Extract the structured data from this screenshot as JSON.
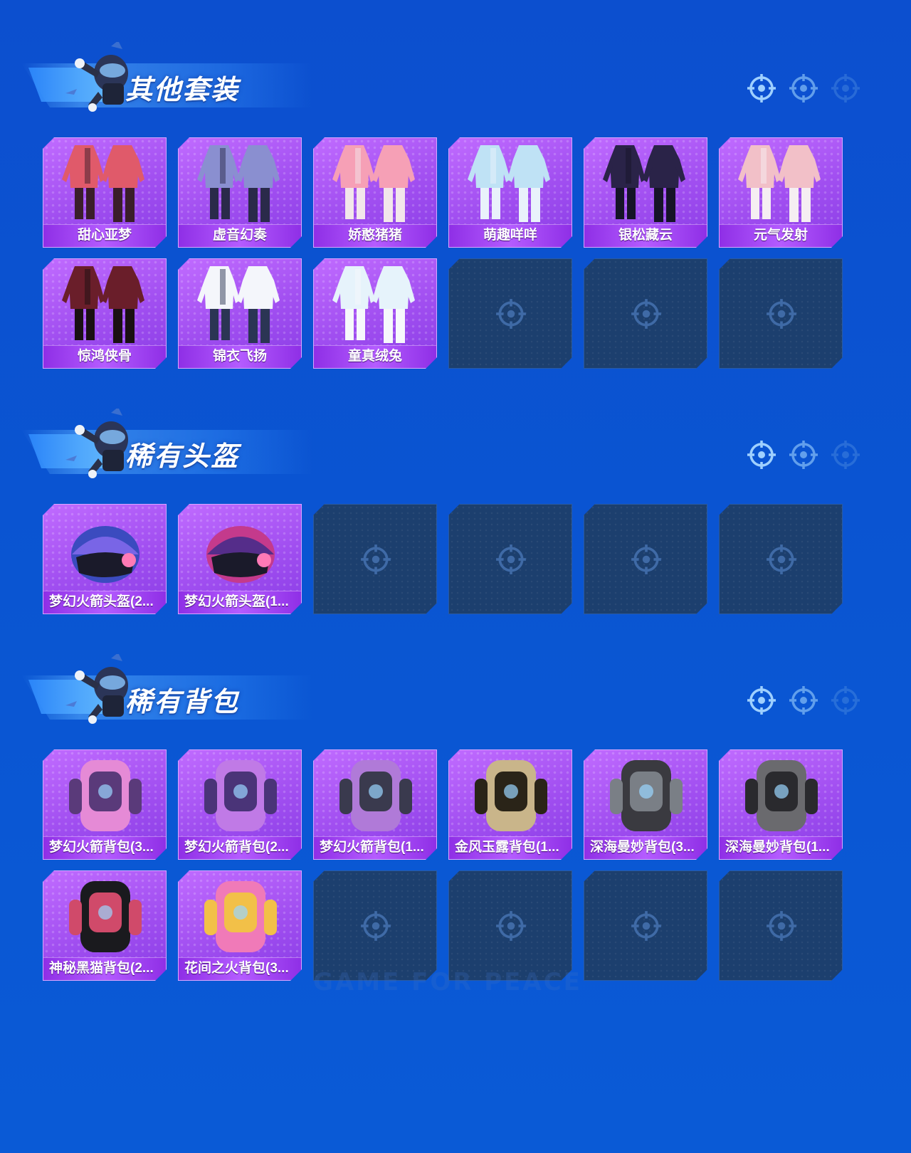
{
  "sections": [
    {
      "title": "其他套装",
      "rows": [
        [
          {
            "label": "甜心亚梦",
            "kind": "outfit",
            "c1": "#e05a6a",
            "c2": "#3a1e2a"
          },
          {
            "label": "虚音幻奏",
            "kind": "outfit",
            "c1": "#8a8fd0",
            "c2": "#2a2a4a"
          },
          {
            "label": "娇憨猪猪",
            "kind": "outfit",
            "c1": "#f6a0b6",
            "c2": "#f2e6ea"
          },
          {
            "label": "萌趣咩咩",
            "kind": "outfit",
            "c1": "#bfe2f5",
            "c2": "#e9f2fb"
          },
          {
            "label": "银松藏云",
            "kind": "outfit",
            "c1": "#2a2348",
            "c2": "#161428"
          },
          {
            "label": "元气发射",
            "kind": "outfit",
            "c1": "#f2c0c8",
            "c2": "#f5eef2"
          }
        ],
        [
          {
            "label": "惊鸿侠骨",
            "kind": "outfit",
            "c1": "#6a1e2a",
            "c2": "#1a1012"
          },
          {
            "label": "锦衣飞扬",
            "kind": "outfit",
            "c1": "#f4f6fb",
            "c2": "#2b3554"
          },
          {
            "label": "童真绒兔",
            "kind": "outfit",
            "c1": "#e6f3fb",
            "c2": "#f6f8fb"
          },
          {
            "label": "",
            "kind": "empty"
          },
          {
            "label": "",
            "kind": "empty"
          },
          {
            "label": "",
            "kind": "empty"
          }
        ]
      ]
    },
    {
      "title": "稀有头盔",
      "rows": [
        [
          {
            "label": "梦幻火箭头盔(2...",
            "kind": "helmet",
            "c1": "#3b4bbf",
            "c2": "#8a6cf0"
          },
          {
            "label": "梦幻火箭头盔(1...",
            "kind": "helmet",
            "c1": "#c43a8c",
            "c2": "#3a2a8a"
          },
          {
            "label": "",
            "kind": "empty"
          },
          {
            "label": "",
            "kind": "empty"
          },
          {
            "label": "",
            "kind": "empty"
          },
          {
            "label": "",
            "kind": "empty"
          }
        ]
      ]
    },
    {
      "title": "稀有背包",
      "rows": [
        [
          {
            "label": "梦幻火箭背包(3...",
            "kind": "pack",
            "c1": "#e58ad6",
            "c2": "#5a3a7a"
          },
          {
            "label": "梦幻火箭背包(2...",
            "kind": "pack",
            "c1": "#c07ae6",
            "c2": "#4a3478"
          },
          {
            "label": "梦幻火箭背包(1...",
            "kind": "pack",
            "c1": "#b07ad8",
            "c2": "#3a3a4e"
          },
          {
            "label": "金风玉露背包(1...",
            "kind": "pack",
            "c1": "#c9b58a",
            "c2": "#2a2418"
          },
          {
            "label": "深海曼妙背包(3...",
            "kind": "pack",
            "c1": "#3a3a40",
            "c2": "#7a7f86"
          },
          {
            "label": "深海曼妙背包(1...",
            "kind": "pack",
            "c1": "#6a6a6e",
            "c2": "#2a2a2e"
          }
        ],
        [
          {
            "label": "神秘黑猫背包(2...",
            "kind": "pack",
            "c1": "#1a1a1e",
            "c2": "#d04a6a"
          },
          {
            "label": "花间之火背包(3...",
            "kind": "pack",
            "c1": "#f07ab8",
            "c2": "#f2c048"
          },
          {
            "label": "",
            "kind": "empty"
          },
          {
            "label": "",
            "kind": "empty"
          },
          {
            "label": "",
            "kind": "empty"
          },
          {
            "label": "",
            "kind": "empty"
          }
        ]
      ]
    }
  ],
  "watermark": "GAME FOR PEACE",
  "colors": {
    "accent": "#a04ef0",
    "background": "#0a55d2",
    "empty_slot": "#1c3f6e"
  }
}
